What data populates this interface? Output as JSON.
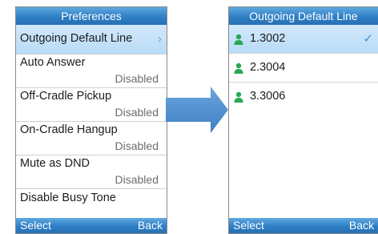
{
  "left": {
    "title": "Preferences",
    "items": [
      {
        "label": "Outgoing Default Line",
        "value": ""
      },
      {
        "label": "Auto Answer",
        "value": "Disabled"
      },
      {
        "label": "Off-Cradle Pickup",
        "value": "Disabled"
      },
      {
        "label": "On-Cradle Hangup",
        "value": "Disabled"
      },
      {
        "label": "Mute as DND",
        "value": "Disabled"
      },
      {
        "label": "Disable Busy Tone",
        "value": ""
      }
    ],
    "softkeys": {
      "left": "Select",
      "right": "Back"
    }
  },
  "right": {
    "title": "Outgoing Default Line",
    "items": [
      {
        "label": "1.3002"
      },
      {
        "label": "2.3004"
      },
      {
        "label": "3.3006"
      }
    ],
    "softkeys": {
      "left": "Select",
      "right": "Back"
    }
  },
  "icons": [
    "chevron-right-icon",
    "person-icon",
    "checkmark-icon",
    "arrow-right-icon"
  ],
  "colors": {
    "accent": "#2f7fc5",
    "selection": "#c6e2f9",
    "person": "#2aa852",
    "check": "#3d8fd6"
  }
}
